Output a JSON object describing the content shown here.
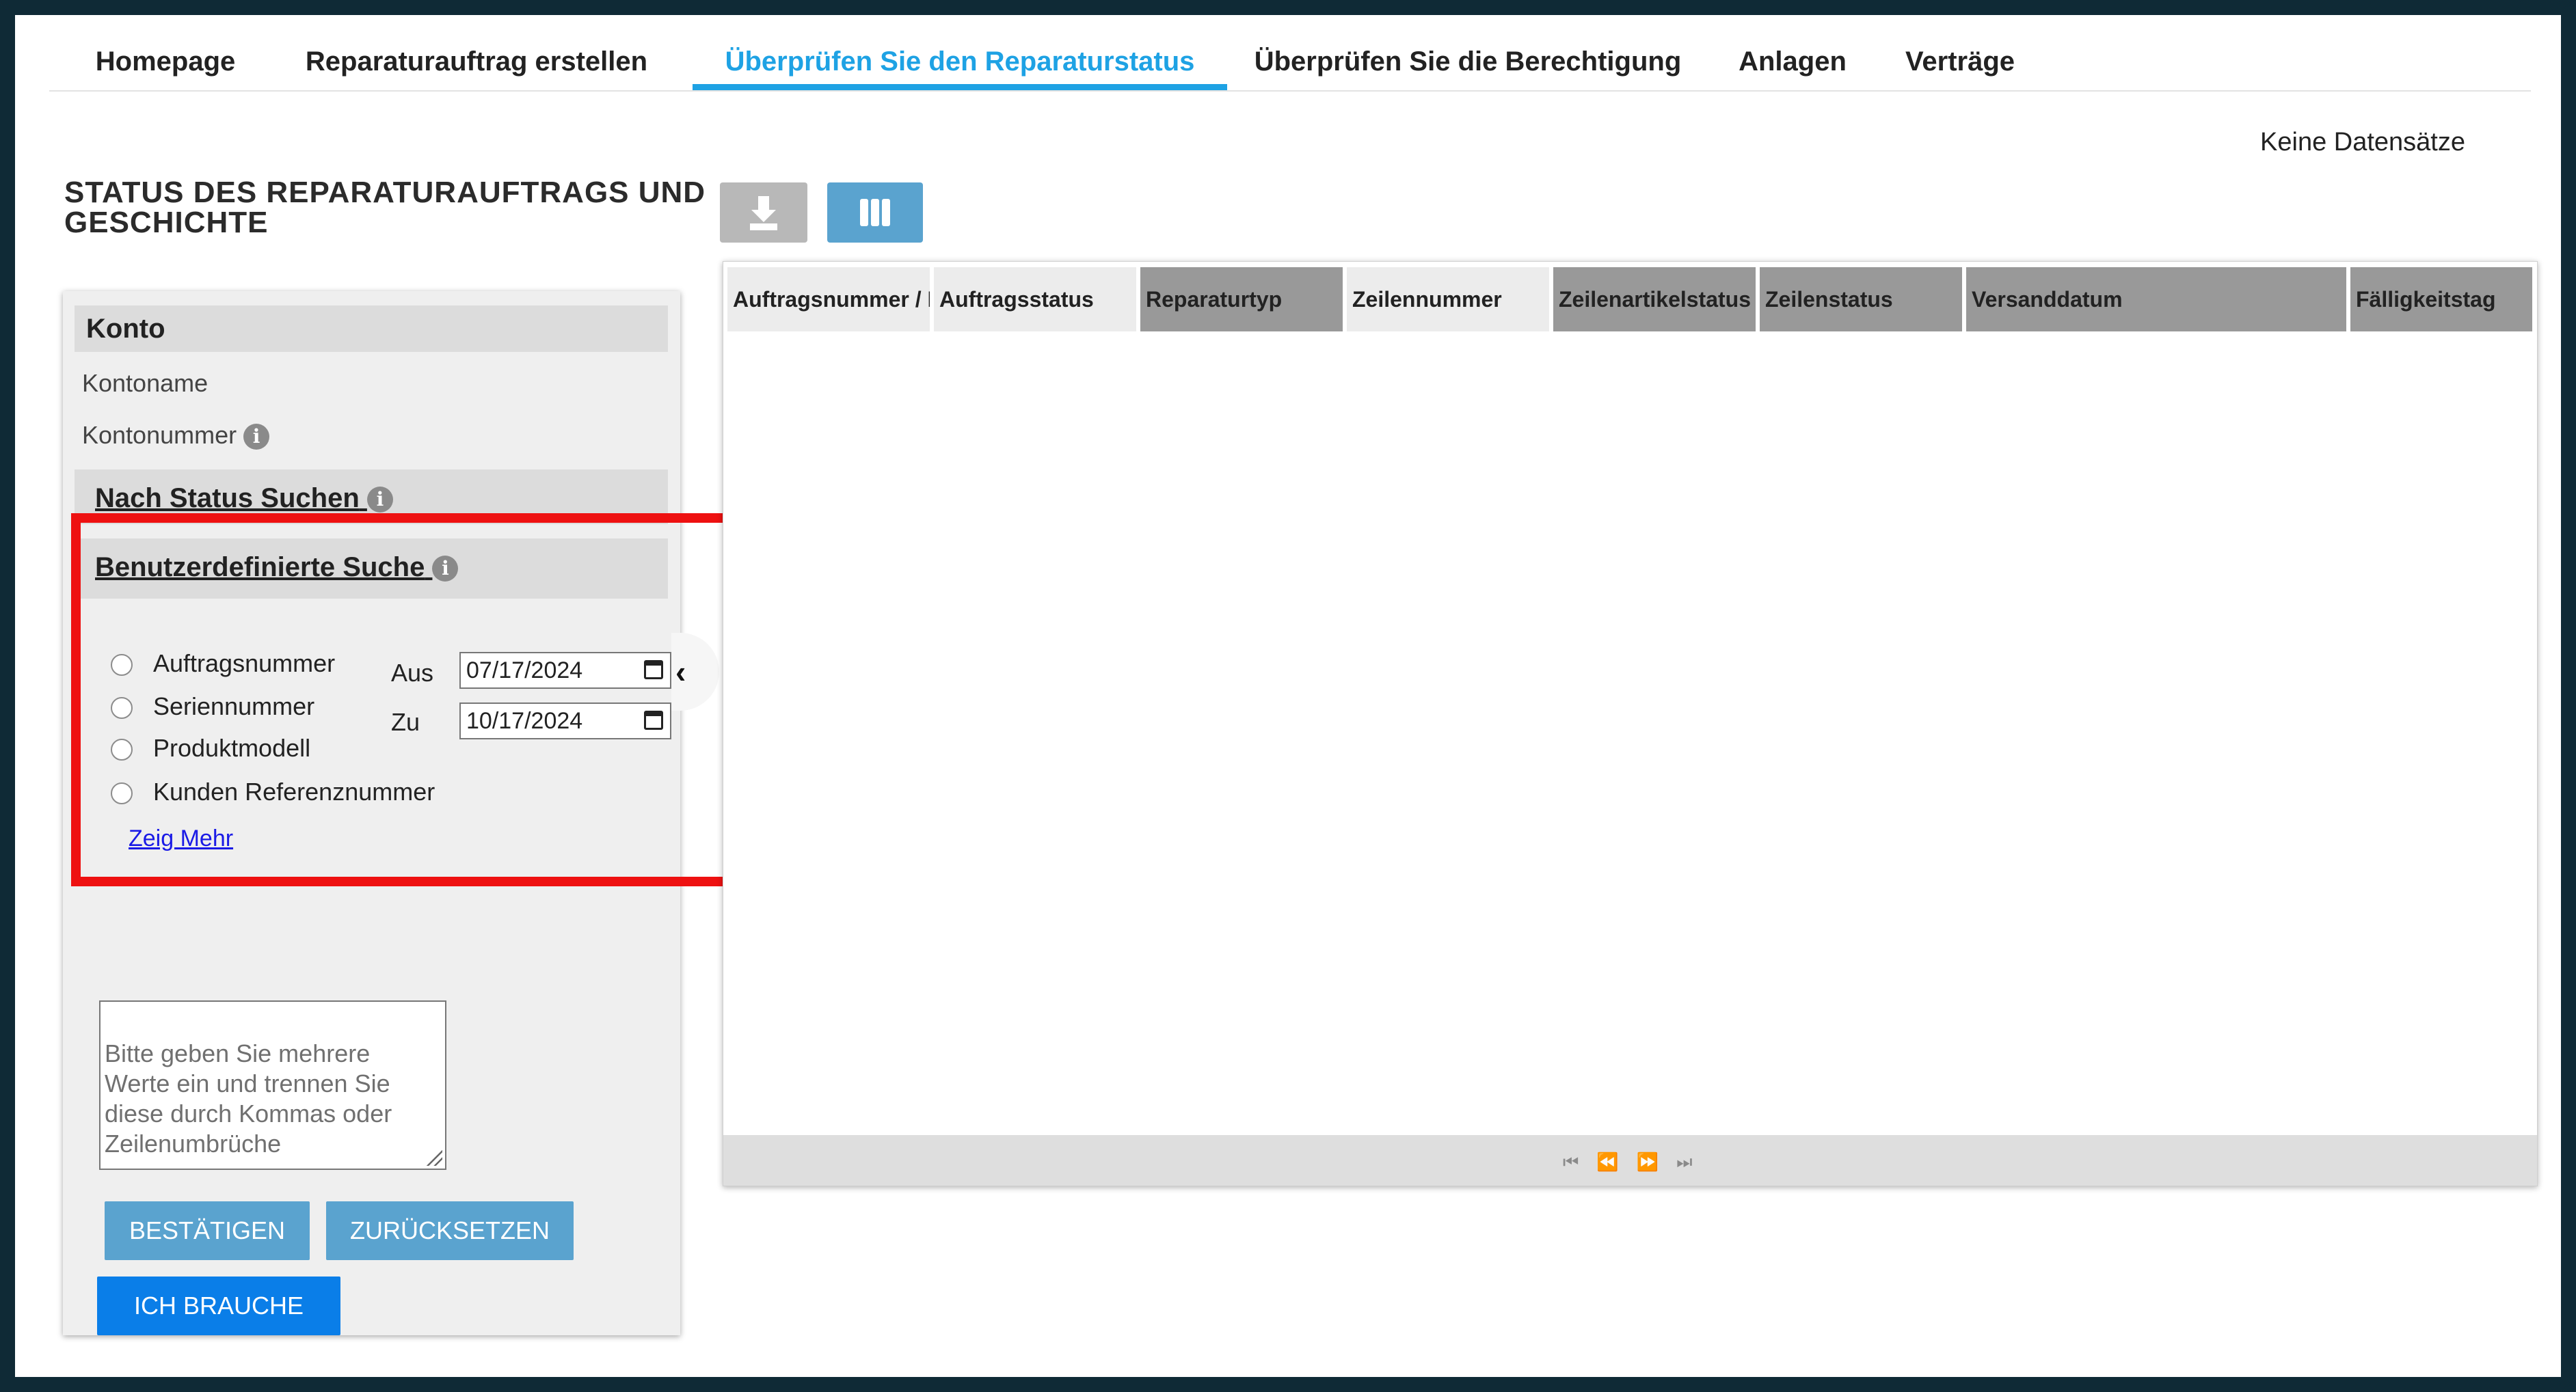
{
  "nav": {
    "tabs": [
      {
        "label": "Homepage"
      },
      {
        "label": "Reparaturauftrag erstellen"
      },
      {
        "label": "Überprüfen Sie den Reparaturstatus"
      },
      {
        "label": "Überprüfen Sie die Berechtigung"
      },
      {
        "label": "Anlagen"
      },
      {
        "label": "Verträge"
      }
    ],
    "active_index": 2
  },
  "page": {
    "title": "STATUS DES REPARATURAUFTRAGS UND GESCHICHTE",
    "no_records": "Keine Datensätze"
  },
  "sidebar": {
    "konto_title": "Konto",
    "account_name_label": "Kontoname",
    "account_number_label": "Kontonummer",
    "status_search_label": "Nach Status Suchen",
    "custom_search_label": "Benutzerdefinierte Suche",
    "search_options": [
      {
        "label": "Auftragsnummer"
      },
      {
        "label": "Seriennummer"
      },
      {
        "label": "Produktmodell"
      },
      {
        "label": "Kunden Referenznummer"
      }
    ],
    "from_label": "Aus",
    "to_label": "Zu",
    "from_date": "07/17/2024",
    "to_date": "10/17/2024",
    "show_more": "Zeig Mehr",
    "textarea_placeholder": "Bitte geben Sie mehrere Werte ein und trennen Sie diese durch Kommas oder Zeilenumbrüche",
    "confirm_label": "BESTÄTIGEN",
    "reset_label": "ZURÜCKSETZEN",
    "help_label": "ICH BRAUCHE HILFE"
  },
  "grid": {
    "columns": [
      {
        "label": "Auftragsnummer / I"
      },
      {
        "label": "Auftragsstatus"
      },
      {
        "label": "Reparaturtyp"
      },
      {
        "label": "Zeilennummer"
      },
      {
        "label": "Zeilenartikelstatus"
      },
      {
        "label": "Zeilenstatus"
      },
      {
        "label": "Versanddatum"
      },
      {
        "label": "Fälligkeitstag"
      }
    ],
    "pager_glyphs": "⏮⏪⏩⏭"
  },
  "colors": {
    "accent": "#1ea2e4",
    "button": "#5aa3cf",
    "help_button": "#0a7ee8",
    "highlight": "#ee1111",
    "frame": "#0f2a36"
  }
}
